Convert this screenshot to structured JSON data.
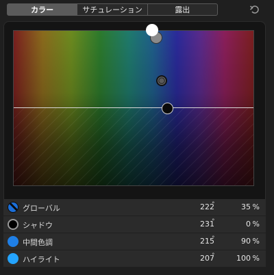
{
  "tabs": [
    {
      "label": "カラー",
      "active": true
    },
    {
      "label": "サチュレーション",
      "active": false
    },
    {
      "label": "露出",
      "active": false
    }
  ],
  "undo_icon": "reset-icon",
  "rows": [
    {
      "label": "グローバル",
      "hue": "222",
      "deg": "°",
      "percent": "35",
      "pct_sign": "%",
      "swatch_color": "#1c6fd8"
    },
    {
      "label": "シャドウ",
      "hue": "231",
      "deg": "°",
      "percent": "0",
      "pct_sign": "%",
      "swatch_color": "#000000"
    },
    {
      "label": "中間色調",
      "hue": "215",
      "deg": "°",
      "percent": "90",
      "pct_sign": "%",
      "swatch_color": "#1f7fe6"
    },
    {
      "label": "ハイライト",
      "hue": "207",
      "deg": "°",
      "percent": "100",
      "pct_sign": "%",
      "swatch_color": "#24a4ff"
    }
  ]
}
